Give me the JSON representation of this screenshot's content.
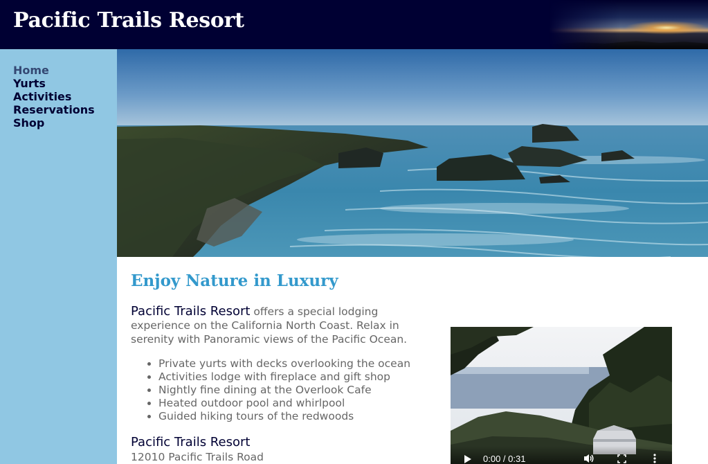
{
  "header": {
    "title": "Pacific Trails Resort"
  },
  "nav": {
    "items": [
      {
        "label": "Home",
        "current": true
      },
      {
        "label": "Yurts"
      },
      {
        "label": "Activities"
      },
      {
        "label": "Reservations"
      },
      {
        "label": "Shop"
      }
    ]
  },
  "main": {
    "heading": "Enjoy Nature in Luxury",
    "intro": {
      "resort_name": "Pacific Trails Resort",
      "text": " offers a special lodging experience on the California North Coast. Relax in serenity with Panoramic views of the Pacific Ocean."
    },
    "features": [
      "Private yurts with decks overlooking the ocean",
      "Activities lodge with fireplace and gift shop",
      "Nightly fine dining at the Overlook Cafe",
      "Heated outdoor pool and whirlpool",
      "Guided hiking tours of the redwoods"
    ],
    "contact": {
      "name": "Pacific Trails Resort",
      "address": "12010 Pacific Trails Road"
    }
  },
  "video": {
    "time": "0:00 / 0:31"
  },
  "colors": {
    "header_bg": "#000033",
    "sidebar_bg": "#90c7e3",
    "heading": "#3399cc",
    "nav_text": "#000033",
    "body_text": "#666666"
  },
  "icons": [
    "play-icon",
    "volume-icon",
    "fullscreen-icon",
    "more-vertical-icon"
  ]
}
